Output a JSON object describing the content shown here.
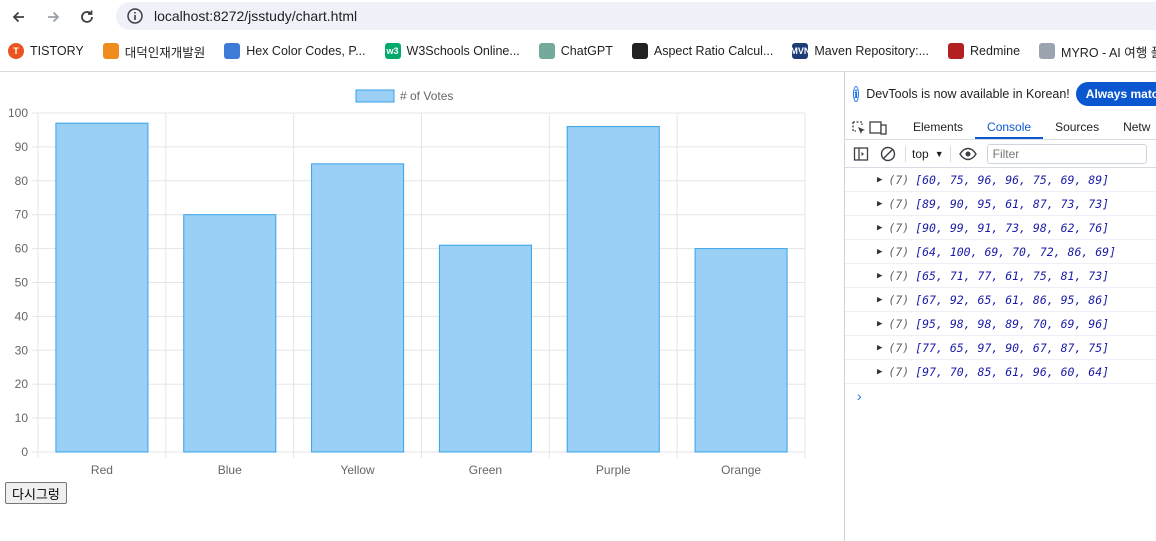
{
  "browser": {
    "url": "localhost:8272/jsstudy/chart.html",
    "bookmarks": [
      {
        "label": "TISTORY",
        "icon": "tistory-icon",
        "color": "#eb531f",
        "glyph": "T"
      },
      {
        "label": "대덕인재개발원",
        "icon": "ddit-icon",
        "color": "#f08c1e",
        "glyph": ""
      },
      {
        "label": "Hex Color Codes, P...",
        "icon": "hex-color-icon",
        "color": "#3d7bd6",
        "glyph": ""
      },
      {
        "label": "W3Schools Online...",
        "icon": "w3schools-icon",
        "color": "#04aa6d",
        "glyph": "w3"
      },
      {
        "label": "ChatGPT",
        "icon": "chatgpt-icon",
        "color": "#74aa9c",
        "glyph": ""
      },
      {
        "label": "Aspect Ratio Calcul...",
        "icon": "aspect-ratio-icon",
        "color": "#222222",
        "glyph": ""
      },
      {
        "label": "Maven Repository:...",
        "icon": "maven-icon",
        "color": "#1e3c78",
        "glyph": "MVN"
      },
      {
        "label": "Redmine",
        "icon": "redmine-icon",
        "color": "#b32024",
        "glyph": ""
      },
      {
        "label": "MYRO - AI 여행 플...",
        "icon": "myro-icon",
        "color": "#9aa4b1",
        "glyph": ""
      }
    ]
  },
  "page": {
    "redraw_button": "다시그렁"
  },
  "chart_data": {
    "type": "bar",
    "categories": [
      "Red",
      "Blue",
      "Yellow",
      "Green",
      "Purple",
      "Orange"
    ],
    "series": [
      {
        "name": "# of Votes",
        "values": [
          97,
          70,
          85,
          61,
          96,
          60
        ]
      }
    ],
    "ylim": [
      0,
      100
    ],
    "yticks": [
      0,
      10,
      20,
      30,
      40,
      50,
      60,
      70,
      80,
      90,
      100
    ],
    "grid": true,
    "legend": "top",
    "colors": {
      "fill": "#9ad0f5",
      "stroke": "#36a2eb",
      "grid": "#e5e5e5",
      "tick": "#666666"
    }
  },
  "devtools": {
    "banner_text": "DevTools is now available in Korean!",
    "banner_button": "Always match Ch",
    "tabs": [
      "Elements",
      "Console",
      "Sources",
      "Netw"
    ],
    "active_tab": "Console",
    "context": "top",
    "filter_placeholder": "Filter",
    "logs": [
      {
        "count": "(7)",
        "values": "[60, 75, 96, 96, 75, 69, 89]"
      },
      {
        "count": "(7)",
        "values": "[89, 90, 95, 61, 87, 73, 73]"
      },
      {
        "count": "(7)",
        "values": "[90, 99, 91, 73, 98, 62, 76]"
      },
      {
        "count": "(7)",
        "values": "[64, 100, 69, 70, 72, 86, 69]"
      },
      {
        "count": "(7)",
        "values": "[65, 71, 77, 61, 75, 81, 73]"
      },
      {
        "count": "(7)",
        "values": "[67, 92, 65, 61, 86, 95, 86]"
      },
      {
        "count": "(7)",
        "values": "[95, 98, 98, 89, 70, 69, 96]"
      },
      {
        "count": "(7)",
        "values": "[77, 65, 97, 90, 67, 87, 75]"
      },
      {
        "count": "(7)",
        "values": "[97, 70, 85, 61, 96, 60, 64]"
      }
    ],
    "prompt": "›"
  }
}
